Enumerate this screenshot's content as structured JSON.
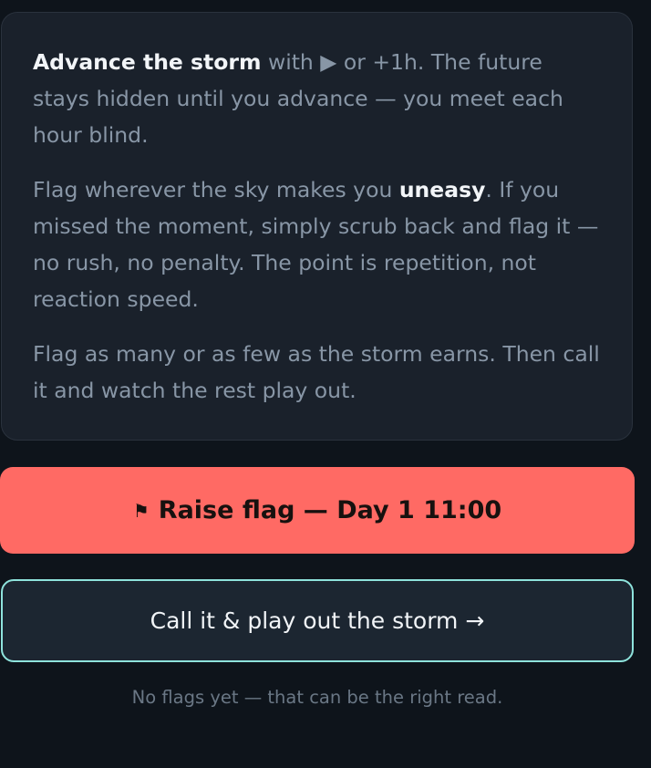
{
  "instructions": {
    "para1": {
      "bold": "Advance the storm",
      "rest": " with ▶ or +1h. The future stays hidden until you advance — you meet each hour blind."
    },
    "para2": {
      "before": "Flag wherever the sky makes you ",
      "bold": "uneasy",
      "after": ". If you missed the moment, simply scrub back and flag it — no rush, no penalty. The point is repetition, not reaction speed."
    },
    "para3": "Flag as many or as few as the storm earns. Then call it and watch the rest play out."
  },
  "actions": {
    "raise_flag": {
      "icon": "flag-icon",
      "glyph": "⚑",
      "label": "Raise flag — Day 1 11:00"
    },
    "call_it": {
      "label": "Call it & play out the storm",
      "arrow": "→"
    }
  },
  "status": "No flags yet — that can be the right read.",
  "colors": {
    "background": "#0e141b",
    "card": "#1a212b",
    "raise_button": "#ff6a64",
    "call_button_border": "#8ee3dc"
  }
}
